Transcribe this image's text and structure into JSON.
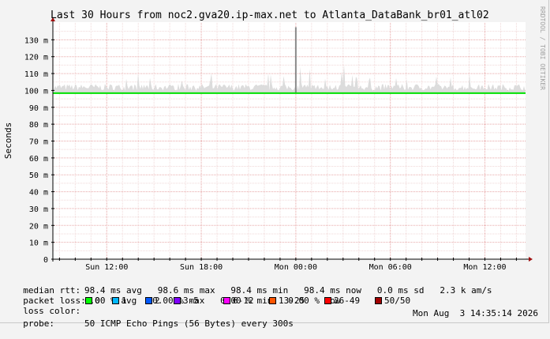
{
  "chart_data": {
    "type": "line",
    "title": "Last 30 Hours from noc2.gva20.ip-max.net to Atlanta_DataBank_br01_atl02",
    "ylabel": "Seconds",
    "side_label": "RRDTOOL / TOBI OETIKER",
    "x_ticks": [
      "Sun 12:00",
      "Sun 18:00",
      "Mon 00:00",
      "Mon 06:00",
      "Mon 12:00"
    ],
    "y_ticks": [
      "0",
      "10 m",
      "20 m",
      "30 m",
      "40 m",
      "50 m",
      "60 m",
      "70 m",
      "80 m",
      "90 m",
      "100 m",
      "110 m",
      "120 m",
      "130 m"
    ],
    "ylim": [
      0,
      0.14
    ],
    "grid": true,
    "series": [
      {
        "name": "median rtt",
        "color": "#00e000",
        "x": [
          "Sun 08:35",
          "Mon 14:35"
        ],
        "values": [
          0.0984,
          0.0984
        ]
      }
    ],
    "spike": {
      "x": "Mon 00:00",
      "value": 0.1375
    }
  },
  "stats": {
    "median_rtt_label": "median rtt:",
    "median_rtt_values": "98.4 ms avg   98.6 ms max   98.4 ms min   98.4 ms now   0.0 ms sd   2.3 k am/s",
    "packet_loss_label": "packet loss:",
    "packet_loss_values": "0.00 % avg   0.00 % max   0.00 % min   0.00 % now",
    "loss_color_label": "loss color:",
    "loss_colors": [
      {
        "label": "0",
        "color": "#00ff00"
      },
      {
        "label": "1",
        "color": "#00b8ff"
      },
      {
        "label": "2",
        "color": "#0059ff"
      },
      {
        "label": "3-5",
        "color": "#8000ff"
      },
      {
        "label": "6-12",
        "color": "#ff00ff"
      },
      {
        "label": "13-25",
        "color": "#ff5500"
      },
      {
        "label": "26-49",
        "color": "#ff0000"
      },
      {
        "label": "50/50",
        "color": "#a10000"
      }
    ],
    "probe_label": "probe:",
    "probe_value": "50 ICMP Echo Pings (56 Bytes) every 300s",
    "timestamp": "Mon Aug  3 14:35:14 2026"
  }
}
